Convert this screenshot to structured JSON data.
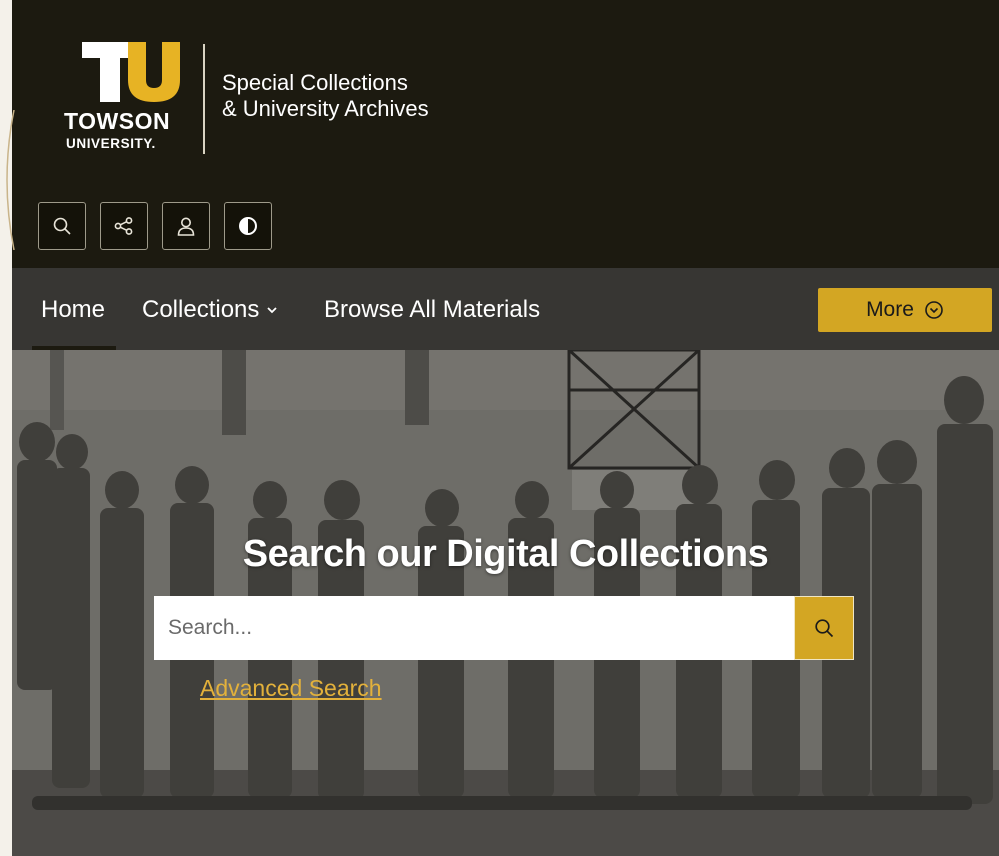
{
  "header": {
    "logo": {
      "initials": "TU",
      "line1": "TOWSON",
      "line2": "UNIVERSITY.",
      "icon": "towson-logo-icon"
    },
    "site_name_line1": "Special Collections",
    "site_name_line2": "& University Archives",
    "utility_icons": [
      "search-icon",
      "share-icon",
      "user-icon",
      "contrast-icon"
    ]
  },
  "nav": {
    "items": [
      {
        "label": "Home"
      },
      {
        "label": "Collections",
        "icon": "chevron-down-icon"
      },
      {
        "label": "Browse All Materials"
      }
    ],
    "more_label": "More",
    "more_icon": "circle-chevron-down-icon"
  },
  "hero": {
    "title": "Search our Digital Collections",
    "search_placeholder": "Search...",
    "search_icon": "search-icon",
    "advanced_search_label": "Advanced Search"
  },
  "colors": {
    "header_bg": "#1c1a10",
    "nav_bg": "#373633",
    "accent_gold": "#d3a623",
    "link_gold": "#e3b13b"
  }
}
